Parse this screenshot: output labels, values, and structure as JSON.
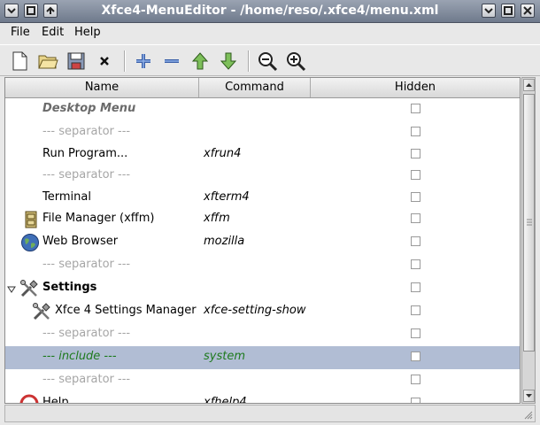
{
  "window": {
    "title": "Xfce4-MenuEditor - /home/reso/.xfce4/menu.xml",
    "controls": {
      "menu": "window-menu-icon",
      "shade": "shade-icon",
      "stick": "stick-icon",
      "minimize": "minimize-icon",
      "maximize": "maximize-icon",
      "close": "close-icon"
    }
  },
  "menubar": {
    "file": "File",
    "edit": "Edit",
    "help": "Help"
  },
  "toolbar": {
    "new": "new-document-icon",
    "open": "open-folder-icon",
    "save": "save-icon",
    "close": "close-x-icon",
    "add": "add-icon",
    "remove": "remove-icon",
    "up": "move-up-icon",
    "down": "move-down-icon",
    "zoom_out": "zoom-out-icon",
    "zoom_in": "zoom-in-icon"
  },
  "columns": {
    "name": "Name",
    "command": "Command",
    "hidden": "Hidden"
  },
  "rows": [
    {
      "name": "Desktop Menu",
      "command": "",
      "hidden": false
    },
    {
      "name": "--- separator ---",
      "command": "",
      "hidden": false
    },
    {
      "name": "Run Program...",
      "command": "xfrun4",
      "hidden": false
    },
    {
      "name": "--- separator ---",
      "command": "",
      "hidden": false
    },
    {
      "name": "Terminal",
      "command": "xfterm4",
      "hidden": false
    },
    {
      "name": "File Manager (xffm)",
      "command": "xffm",
      "hidden": false,
      "icon": "file-cabinet-icon"
    },
    {
      "name": "Web Browser",
      "command": "mozilla",
      "hidden": false,
      "icon": "globe-icon"
    },
    {
      "name": "--- separator ---",
      "command": "",
      "hidden": false
    },
    {
      "name": "Settings",
      "command": "",
      "hidden": false,
      "icon": "tools-icon",
      "expanded": true
    },
    {
      "name": "Xfce 4 Settings Manager",
      "command": "xfce-setting-show",
      "hidden": false,
      "icon": "tools-icon"
    },
    {
      "name": "--- separator ---",
      "command": "",
      "hidden": false
    },
    {
      "name": "--- include ---",
      "command": "system",
      "hidden": false,
      "selected": true
    },
    {
      "name": "--- separator ---",
      "command": "",
      "hidden": false
    },
    {
      "name": "Help",
      "command": "xfhelp4",
      "hidden": false,
      "icon": "help-icon"
    }
  ],
  "colors": {
    "selection": "#b1bdd4",
    "include_text": "#1e7a1e",
    "separator_text": "#a6a6a6"
  }
}
